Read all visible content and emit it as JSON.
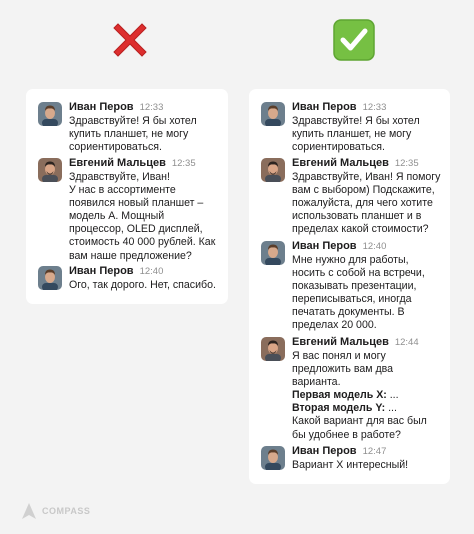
{
  "bad_example": {
    "mark_icon": "red-cross-icon",
    "messages": [
      {
        "name": "Иван Перов",
        "time": "12:33",
        "lines": [
          "Здравствуйте! Я бы хотел",
          "купить планшет, не могу",
          "сориентироваться."
        ]
      },
      {
        "name": "Евгений Мальцев",
        "time": "12:35",
        "lines": [
          "Здравствуйте, Иван!",
          "У нас в ассортименте",
          "появился новый планшет –",
          "модель А. Мощный",
          "процессор, OLED дисплей,",
          "стоимость 40 000 рублей. Как",
          "вам наше предложение?"
        ]
      },
      {
        "name": "Иван Перов",
        "time": "12:40",
        "lines": [
          "Ого, так дорого. Нет, спасибо."
        ]
      }
    ]
  },
  "good_example": {
    "mark_icon": "green-check-icon",
    "messages": [
      {
        "name": "Иван Перов",
        "time": "12:33",
        "lines": [
          "Здравствуйте! Я бы хотел",
          "купить планшет, не могу",
          "сориентироваться."
        ]
      },
      {
        "name": "Евгений Мальцев",
        "time": "12:35",
        "lines": [
          "Здравствуйте, Иван! Я помогу",
          "вам с выбором) Подскажите,",
          "пожалуйста, для чего хотите",
          "использовать планшет и в",
          "пределах какой стоимости?"
        ]
      },
      {
        "name": "Иван Перов",
        "time": "12:40",
        "lines": [
          "Мне нужно для работы,",
          "носить с собой на встречи,",
          "показывать презентации,",
          "переписываться, иногда",
          "печатать документы. В",
          "пределах 20 000."
        ]
      },
      {
        "name": "Евгений Мальцев",
        "time": "12:44",
        "lines": [
          "Я вас понял и могу",
          "предложить вам два",
          "варианта."
        ],
        "bold_lines": [
          {
            "label": "Первая модель X:",
            "rest": " ..."
          },
          {
            "label": "Вторая модель Y:",
            "rest": " ..."
          }
        ],
        "after_lines": [
          "Какой вариант для вас был",
          "бы удобнее в работе?"
        ]
      },
      {
        "name": "Иван Перов",
        "time": "12:47",
        "lines": [
          "Вариант X интересный!"
        ]
      }
    ]
  },
  "logo": {
    "text": "COMPASS",
    "icon": "compass-logo-icon"
  },
  "colors": {
    "cross": "#dd2e2e",
    "check": "#6abf2e",
    "card": "#ffffff",
    "background": "#f3f3f3"
  }
}
